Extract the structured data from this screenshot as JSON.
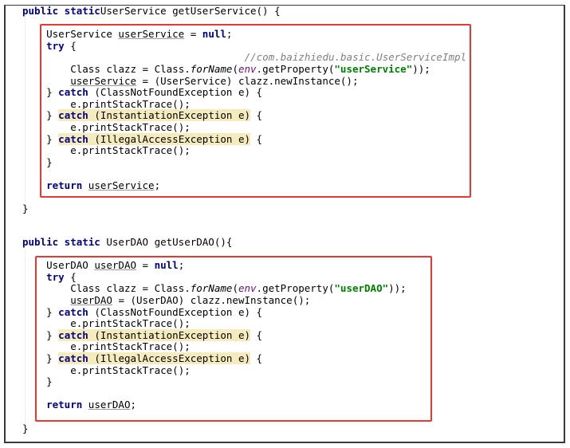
{
  "accent_colors": {
    "highlight_box": "#e53935",
    "keyword": "#000080",
    "string": "#008000",
    "field": "#660e7a",
    "comment": "#808080",
    "occurrence_highlight": "#f6ebbc"
  },
  "blocks": [
    {
      "name": "get-user-service-method",
      "lines": [
        [
          [
            0,
            "kw",
            "public static"
          ],
          [
            0,
            "",
            "UserService getUserService() {"
          ]
        ],
        [],
        [
          [
            4,
            "",
            "UserService "
          ],
          [
            0,
            "ul",
            "userService"
          ],
          [
            0,
            "",
            " = "
          ],
          [
            0,
            "kw",
            "null"
          ],
          [
            0,
            "",
            ";"
          ]
        ],
        [
          [
            4,
            "kw",
            "try"
          ],
          [
            0,
            "",
            " {"
          ]
        ],
        [
          [
            37,
            "cm",
            "//com.baizhiedu.basic.UserServiceImpl"
          ]
        ],
        [
          [
            8,
            "",
            "Class clazz = Class."
          ],
          [
            0,
            "it",
            "forName"
          ],
          [
            0,
            "",
            "("
          ],
          [
            0,
            "env",
            "env"
          ],
          [
            0,
            "",
            ".getProperty("
          ],
          [
            0,
            "str",
            "\"userService\""
          ],
          [
            0,
            "",
            "));"
          ]
        ],
        [
          [
            8,
            "ul",
            "userService"
          ],
          [
            0,
            "",
            " = (UserService) clazz.newInstance();"
          ]
        ],
        [
          [
            4,
            "",
            "} "
          ],
          [
            0,
            "kw",
            "catch"
          ],
          [
            0,
            "",
            " (ClassNotFoundException e) {"
          ]
        ],
        [
          [
            8,
            "",
            "e.printStackTrace();"
          ]
        ],
        [
          [
            4,
            "",
            "} "
          ],
          [
            0,
            "kw hl",
            "catch"
          ],
          [
            0,
            "hl",
            " (InstantiationException e)"
          ],
          [
            0,
            "",
            " {"
          ]
        ],
        [
          [
            8,
            "",
            "e.printStackTrace();"
          ]
        ],
        [
          [
            4,
            "",
            "} "
          ],
          [
            0,
            "kw hl",
            "catch"
          ],
          [
            0,
            "hl",
            " (IllegalAccessException e)"
          ],
          [
            0,
            "",
            " {"
          ]
        ],
        [
          [
            8,
            "",
            "e.printStackTrace();"
          ]
        ],
        [
          [
            4,
            "",
            "}"
          ]
        ],
        [],
        [
          [
            4,
            "kw",
            "return"
          ],
          [
            0,
            "",
            " "
          ],
          [
            0,
            "ul",
            "userService"
          ],
          [
            0,
            "",
            ";"
          ]
        ],
        [],
        [
          [
            0,
            "",
            "}"
          ]
        ]
      ]
    },
    {
      "name": "get-user-dao-method",
      "lines": [
        [
          [
            0,
            "kw",
            "public static"
          ],
          [
            0,
            "",
            " UserDAO getUserDAO(){"
          ]
        ],
        [],
        [
          [
            4,
            "",
            "UserDAO "
          ],
          [
            0,
            "ul",
            "userDAO"
          ],
          [
            0,
            "",
            " = "
          ],
          [
            0,
            "kw",
            "null"
          ],
          [
            0,
            "",
            ";"
          ]
        ],
        [
          [
            4,
            "kw",
            "try"
          ],
          [
            0,
            "",
            " {"
          ]
        ],
        [
          [
            8,
            "",
            "Class clazz = Class."
          ],
          [
            0,
            "it",
            "forName"
          ],
          [
            0,
            "",
            "("
          ],
          [
            0,
            "env",
            "env"
          ],
          [
            0,
            "",
            ".getProperty("
          ],
          [
            0,
            "str",
            "\"userDAO\""
          ],
          [
            0,
            "",
            "));"
          ]
        ],
        [
          [
            8,
            "ul",
            "userDAO"
          ],
          [
            0,
            "",
            " = (UserDAO) clazz.newInstance();"
          ]
        ],
        [
          [
            4,
            "",
            "} "
          ],
          [
            0,
            "kw",
            "catch"
          ],
          [
            0,
            "",
            " (ClassNotFoundException e) {"
          ]
        ],
        [
          [
            8,
            "",
            "e.printStackTrace();"
          ]
        ],
        [
          [
            4,
            "",
            "} "
          ],
          [
            0,
            "kw hl",
            "catch"
          ],
          [
            0,
            "hl",
            " (InstantiationException e)"
          ],
          [
            0,
            "",
            " {"
          ]
        ],
        [
          [
            8,
            "",
            "e.printStackTrace();"
          ]
        ],
        [
          [
            4,
            "",
            "} "
          ],
          [
            0,
            "kw hl",
            "catch"
          ],
          [
            0,
            "hl",
            " (IllegalAccessException e)"
          ],
          [
            0,
            "",
            " {"
          ]
        ],
        [
          [
            8,
            "",
            "e.printStackTrace();"
          ]
        ],
        [
          [
            4,
            "",
            "}"
          ]
        ],
        [],
        [
          [
            4,
            "kw",
            "return"
          ],
          [
            0,
            "",
            " "
          ],
          [
            0,
            "ul",
            "userDAO"
          ],
          [
            0,
            "",
            ";"
          ]
        ],
        [],
        [
          [
            0,
            "",
            "}"
          ]
        ]
      ]
    }
  ]
}
